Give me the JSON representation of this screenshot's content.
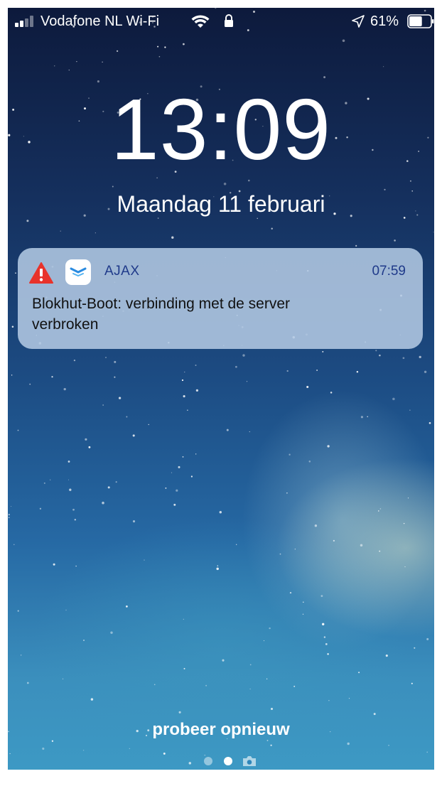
{
  "status_bar": {
    "signal_icon": "signal-bars-icon",
    "carrier": "Vodafone NL Wi-Fi",
    "wifi_icon": "wifi-icon",
    "lock_icon": "lock-icon",
    "location_icon": "location-arrow-icon",
    "battery_percent": "61%",
    "battery_level": 0.61
  },
  "lock_screen": {
    "time": "13:09",
    "date": "Maandag 11 februari"
  },
  "notification": {
    "alert_icon": "warning-triangle-icon",
    "app_icon": "ajax-app-icon",
    "app_name": "AJAX",
    "time": "07:59",
    "message": "Blokhut-Boot: verbinding met de server verbroken"
  },
  "bottom": {
    "hint": "probeer opnieuw",
    "page_count": 2,
    "current_page": 2,
    "camera_icon": "camera-icon"
  },
  "colors": {
    "notification_accent": "#1f3a8a",
    "alert_red": "#e8332b",
    "sky_top": "#0d1a3c",
    "sky_bottom": "#3d99c4"
  }
}
